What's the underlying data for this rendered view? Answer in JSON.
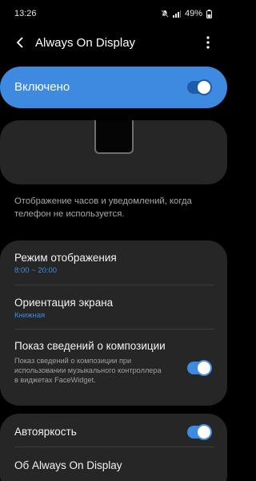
{
  "status_bar": {
    "time": "13:26",
    "battery": "49%",
    "icons": [
      "silent-icon",
      "signal-icon",
      "battery-icon"
    ]
  },
  "app_bar": {
    "title": "Always On Display",
    "back_icon": "back-arrow-icon",
    "more_icon": "more-vert-icon"
  },
  "master_switch": {
    "label": "Включено",
    "on": true
  },
  "description": "Отображение часов и уведомлений, когда телефон не используется.",
  "settings": {
    "display_mode": {
      "title": "Режим отображения",
      "value": "8:00 ~ 20:00"
    },
    "orientation": {
      "title": "Ориентация экрана",
      "value": "Книжная"
    },
    "music_info": {
      "title": "Показ сведений о композиции",
      "description": "Показ сведений о композиции при использовании музыкального контроллера в виджетах FaceWidget.",
      "on": true
    },
    "auto_brightness": {
      "title": "Автояркость",
      "on": true
    },
    "about": {
      "title": "Об Always On Display"
    }
  },
  "colors": {
    "accent": "#3e8ae0",
    "card": "#262626",
    "background": "#000000"
  }
}
